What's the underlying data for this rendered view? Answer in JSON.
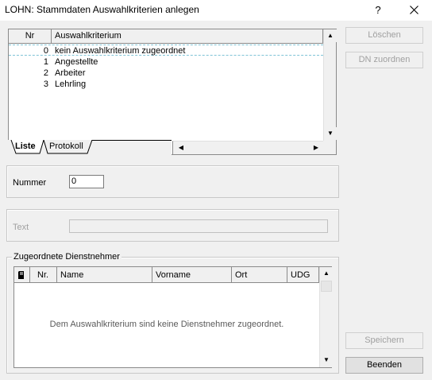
{
  "window": {
    "title": "LOHN: Stammdaten Auswahlkriterien anlegen",
    "help_label": "?",
    "close_label": "✕"
  },
  "list": {
    "columns": [
      "Nr",
      "Auswahlkriterium"
    ],
    "rows": [
      {
        "nr": "0",
        "label": "kein Auswahlkriterium zugeordnet"
      },
      {
        "nr": "1",
        "label": "Angestellte"
      },
      {
        "nr": "2",
        "label": "Arbeiter"
      },
      {
        "nr": "3",
        "label": "Lehrling"
      }
    ],
    "tabs": [
      "Liste",
      "Protokoll"
    ]
  },
  "buttons": {
    "delete": "Löschen",
    "assign": "DN zuordnen",
    "save": "Speichern",
    "exit": "Beenden"
  },
  "fields": {
    "number_label": "Nummer",
    "number_value": "0",
    "text_label": "Text",
    "text_value": ""
  },
  "assigned": {
    "group_title": "Zugeordnete Dienstnehmer",
    "columns": [
      "Nr.",
      "Name",
      "Vorname",
      "Ort",
      "UDG"
    ],
    "empty_message": "Dem Auswahlkriterium sind keine Dienstnehmer zugeordnet."
  },
  "icons": {
    "help": "help-icon",
    "close": "close-icon",
    "grid_header": "document-icon"
  }
}
